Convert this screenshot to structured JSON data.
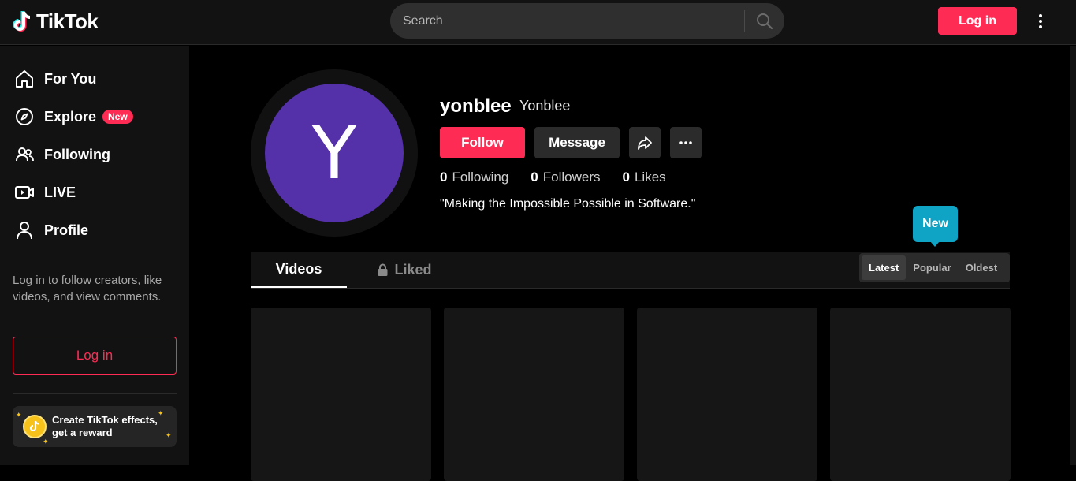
{
  "header": {
    "logo_text": "TikTok",
    "search_placeholder": "Search",
    "login_label": "Log in"
  },
  "sidebar": {
    "items": [
      {
        "label": "For You",
        "icon": "home-icon"
      },
      {
        "label": "Explore",
        "icon": "compass-icon",
        "badge": "New"
      },
      {
        "label": "Following",
        "icon": "users-icon"
      },
      {
        "label": "LIVE",
        "icon": "live-icon"
      },
      {
        "label": "Profile",
        "icon": "person-icon"
      }
    ],
    "login_prompt": "Log in to follow creators, like videos, and view comments.",
    "login_label": "Log in",
    "effects_line1": "Create TikTok effects,",
    "effects_line2": "get a reward"
  },
  "profile": {
    "avatar_letter": "Y",
    "avatar_color": "#5431a8",
    "username": "yonblee",
    "nickname": "Yonblee",
    "follow_label": "Follow",
    "message_label": "Message",
    "stats": [
      {
        "value": "0",
        "label": "Following"
      },
      {
        "value": "0",
        "label": "Followers"
      },
      {
        "value": "0",
        "label": "Likes"
      }
    ],
    "bio": "\"Making the Impossible Possible in Software.\""
  },
  "tabs": {
    "videos_label": "Videos",
    "liked_label": "Liked",
    "tooltip": "New",
    "sort_options": [
      "Latest",
      "Popular",
      "Oldest"
    ],
    "sort_selected": "Latest"
  },
  "colors": {
    "accent": "#fe2c55",
    "tooltip": "#0fa3c6",
    "background": "#000000"
  }
}
